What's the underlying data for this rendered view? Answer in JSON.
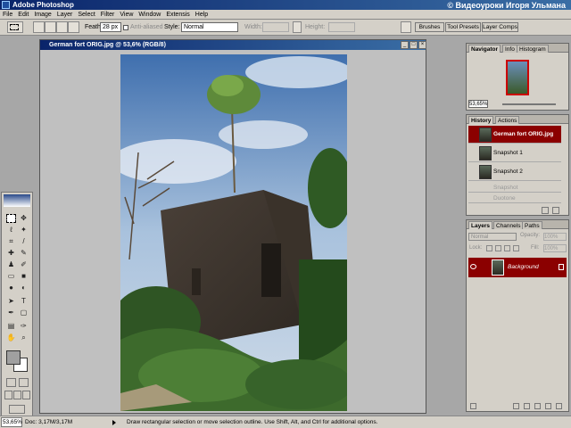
{
  "app": {
    "title": "Adobe Photoshop",
    "watermark": "© Видеоуроки Игоря Ульмана"
  },
  "menu": [
    "File",
    "Edit",
    "Image",
    "Layer",
    "Select",
    "Filter",
    "View",
    "Window",
    "Extensis",
    "Help"
  ],
  "options": {
    "feather_label": "Feather:",
    "feather_value": "28 px",
    "antialiased_label": "Anti-aliased",
    "style_label": "Style:",
    "style_value": "Normal",
    "width_label": "Width:",
    "height_label": "Height:"
  },
  "palette_well": [
    "Brushes",
    "Tool Presets",
    "Layer Comps"
  ],
  "document": {
    "title": "German fort ORIG.jpg @ 53,6% (RGB/8)"
  },
  "navigator": {
    "tabs": [
      "Navigator",
      "Info",
      "Histogram"
    ],
    "zoom": "53,65%"
  },
  "history": {
    "tabs": [
      "History",
      "Actions"
    ],
    "rows": [
      "German fort ORIG.jpg",
      "Snapshot 1",
      "Snapshot 2",
      "Snapshot",
      "Duotone"
    ]
  },
  "layers": {
    "tabs": [
      "Layers",
      "Channels",
      "Paths"
    ],
    "blend": "Normal",
    "opacity_label": "Opacity:",
    "opacity": "100%",
    "lock_label": "Lock:",
    "fill_label": "Fill:",
    "fill": "100%",
    "layer_name": "Background"
  },
  "status": {
    "zoom": "53,65%",
    "doc": "Doc: 3,17M/3,17M",
    "hint": "Draw rectangular selection or move selection outline.  Use Shift, Alt, and Ctrl for additional options."
  },
  "colors": {
    "history_active": "#8b0000",
    "layer_active": "#8b0000"
  }
}
